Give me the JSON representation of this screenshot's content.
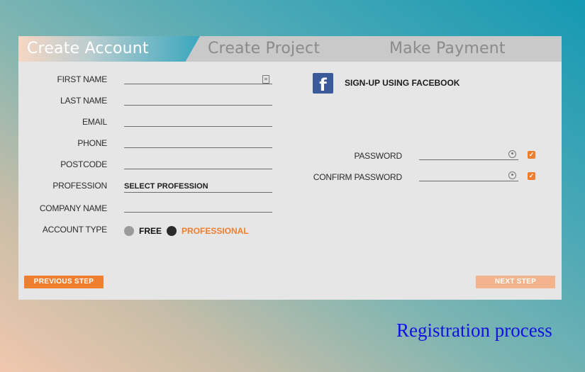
{
  "tabs": {
    "create_account": "Create Account",
    "create_project": "Create Project",
    "make_payment": "Make Payment"
  },
  "form": {
    "first_name_label": "FIRST NAME",
    "last_name_label": "LAST NAME",
    "email_label": "EMAIL",
    "phone_label": "PHONE",
    "postcode_label": "POSTCODE",
    "profession_label": "PROFESSION",
    "profession_value": "SELECT PROFESSION",
    "company_name_label": "COMPANY NAME",
    "account_type_label": "ACCOUNT TYPE",
    "account_type_free": "FREE",
    "account_type_professional": "PROFESSIONAL"
  },
  "social": {
    "facebook_label": "SIGN-UP USING FACEBOOK",
    "facebook_glyph": "f"
  },
  "password": {
    "password_label": "PASSWORD",
    "confirm_label": "CONFIRM PASSWORD"
  },
  "buttons": {
    "previous_label": "PREVIOUS STEP",
    "next_label": "NEXT STEP"
  },
  "caption": "Registration process",
  "colors": {
    "accent": "#ef7e2f",
    "accent_disabled": "#f2b38e",
    "facebook": "#3b5a9a",
    "caption": "#1111e0"
  }
}
